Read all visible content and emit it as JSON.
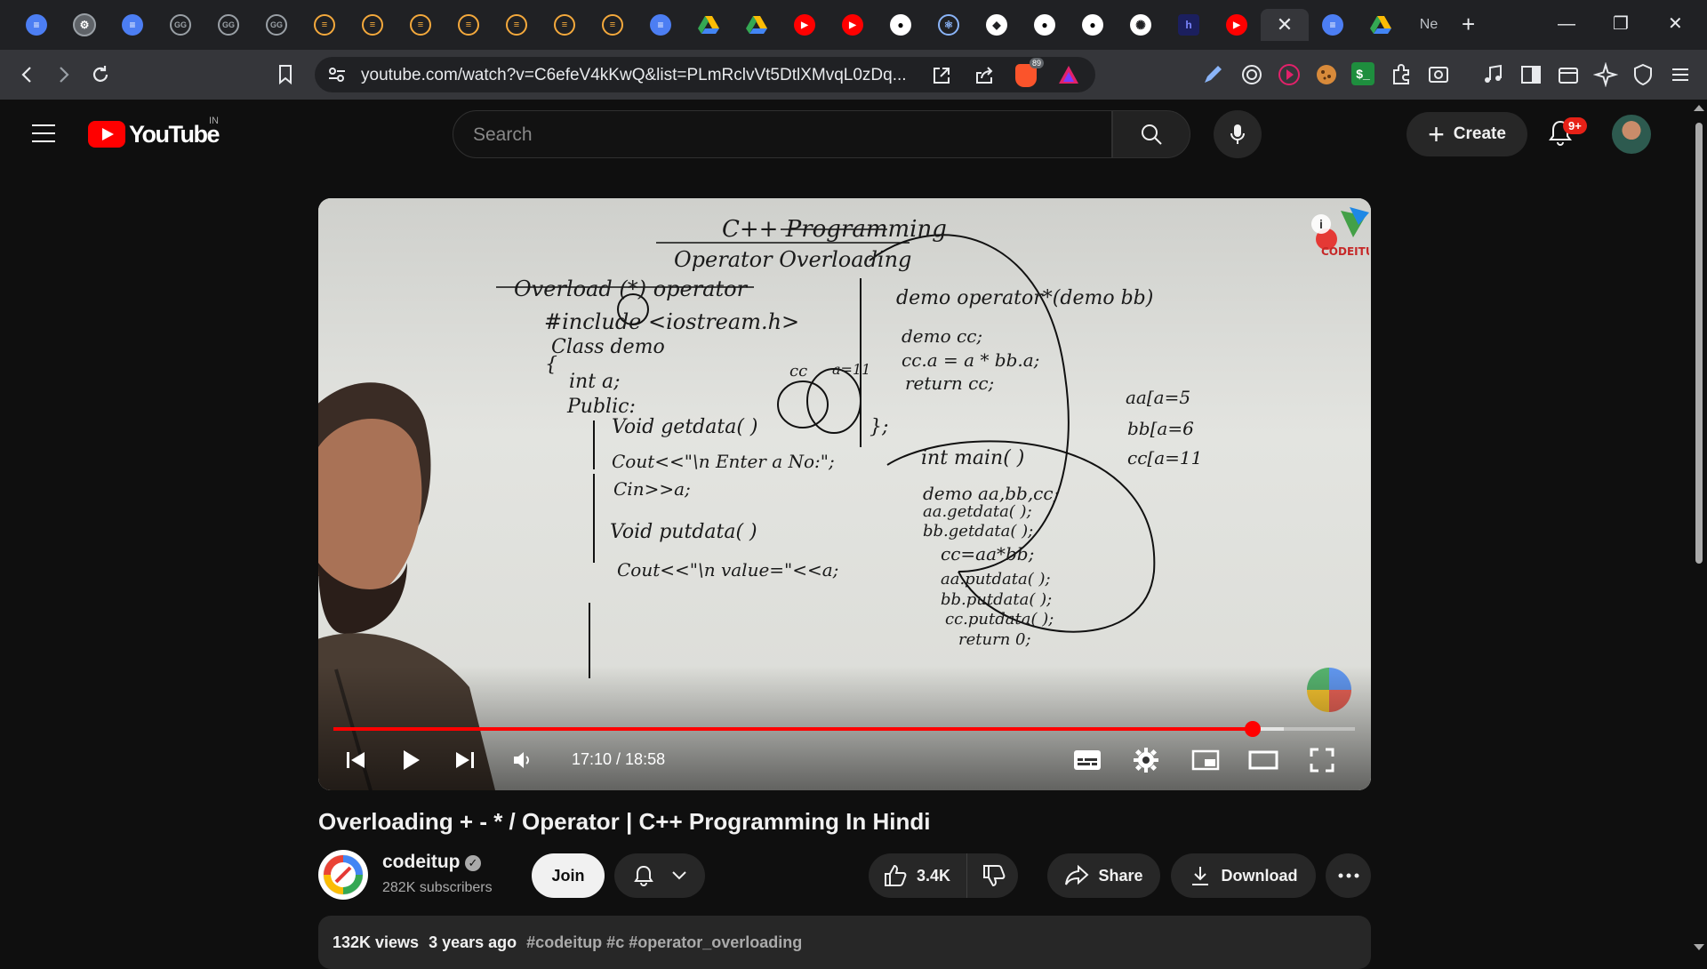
{
  "browser": {
    "tabs": [
      {
        "icon": "google-docs-icon"
      },
      {
        "icon": "settings-gear-icon"
      },
      {
        "icon": "google-docs-icon"
      },
      {
        "icon": "geeksforgeeks-icon",
        "text": "GG"
      },
      {
        "icon": "geeksforgeeks-icon",
        "text": "GG"
      },
      {
        "icon": "geeksforgeeks-icon",
        "text": "GG"
      },
      {
        "icon": "sort-icon"
      },
      {
        "icon": "sort-icon"
      },
      {
        "icon": "sort-icon"
      },
      {
        "icon": "sort-icon"
      },
      {
        "icon": "sort-icon"
      },
      {
        "icon": "sort-icon"
      },
      {
        "icon": "sort-icon"
      },
      {
        "icon": "google-docs-icon"
      },
      {
        "icon": "google-drive-icon"
      },
      {
        "icon": "google-drive-icon"
      },
      {
        "icon": "youtube-icon"
      },
      {
        "icon": "youtube-icon"
      },
      {
        "icon": "github-icon"
      },
      {
        "icon": "react-icon"
      },
      {
        "icon": "shield-icon"
      },
      {
        "icon": "github-icon"
      },
      {
        "icon": "github-icon"
      },
      {
        "icon": "openai-icon"
      },
      {
        "icon": "h-icon"
      },
      {
        "icon": "youtube-icon"
      },
      {
        "icon": "close-icon",
        "active": true
      },
      {
        "icon": "google-docs-icon"
      },
      {
        "icon": "google-drive-icon"
      },
      {
        "icon": "text",
        "text": "Ne"
      }
    ],
    "new_tab": "+",
    "window_controls": {
      "minimize": "—",
      "restore": "❐",
      "close": "✕"
    },
    "url": "youtube.com/watch?v=C6efeV4kKwQ&list=PLmRclvVt5DtlXMvqL0zDq...",
    "brave_badge": "89"
  },
  "youtube": {
    "logo_text": "YouTube",
    "region": "IN",
    "search_placeholder": "Search",
    "create_label": "Create",
    "notification_count": "9+"
  },
  "player": {
    "time_display": "17:10 / 18:58",
    "progress_played": 0.9,
    "progress_buffered": 0.93,
    "whiteboard": [
      "C++ Programming",
      "Operator Overloading",
      "Overload (*) operator",
      "#include <iostream.h>",
      "Class demo",
      "{",
      "int a;",
      "Public:",
      "Void getdata( )",
      "Cout<<\"\\n Enter a No:\";",
      "Cin>>a;",
      "Void putdata( )",
      "Cout<<\"\\n value=\"<<a;",
      "demo operator*(demo bb)",
      "demo cc;",
      "cc.a = a * bb.a;",
      "return cc;",
      "};",
      "int main( )",
      "demo aa,bb,cc;",
      "aa.getdata( );",
      "bb.getdata( );",
      "cc=aa*bb;",
      "aa.putdata( );",
      "bb.putdata( );",
      "cc.putdata( );",
      "return 0;",
      "cc",
      "a=11",
      "aa[a=5",
      "bb[a=6",
      "cc[a=11"
    ]
  },
  "video": {
    "title": "Overloading + - * / Operator | C++ Programming In Hindi",
    "channel": "codeitup",
    "subscribers": "282K subscribers",
    "join_label": "Join",
    "likes": "3.4K",
    "share_label": "Share",
    "download_label": "Download",
    "views": "132K views",
    "age": "3 years ago",
    "hashtags": "#codeitup #c #operator_overloading"
  },
  "colors": {
    "accent": "#ff0000",
    "background": "#0f0f0f",
    "surface": "#272727"
  }
}
